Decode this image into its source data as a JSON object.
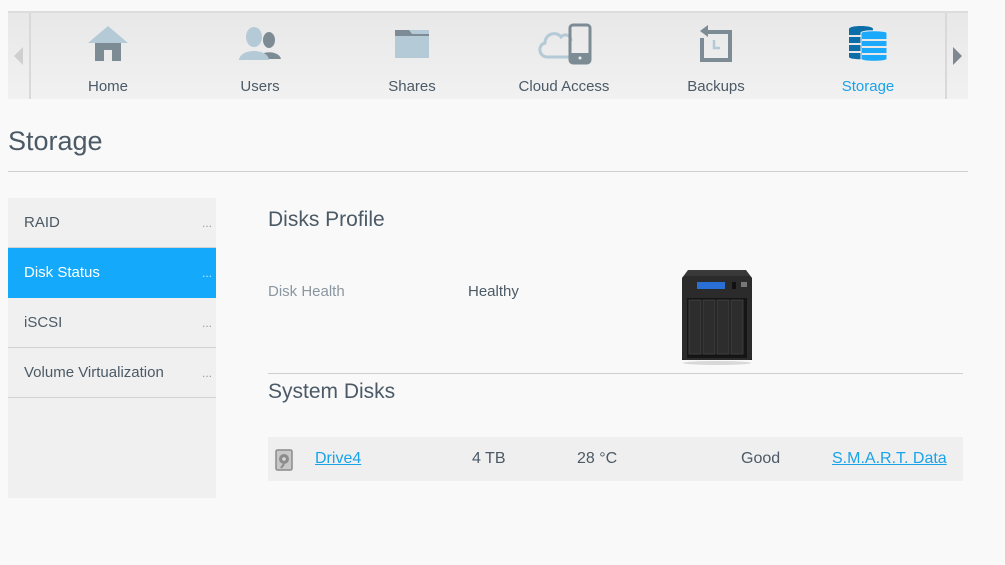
{
  "nav": {
    "items": [
      {
        "label": "Home",
        "icon": "home-icon",
        "active": false
      },
      {
        "label": "Users",
        "icon": "users-icon",
        "active": false
      },
      {
        "label": "Shares",
        "icon": "folder-icon",
        "active": false
      },
      {
        "label": "Cloud Access",
        "icon": "cloud-device-icon",
        "active": false
      },
      {
        "label": "Backups",
        "icon": "backup-clock-icon",
        "active": false
      },
      {
        "label": "Storage",
        "icon": "database-icon",
        "active": true
      }
    ],
    "accent_color": "#1aa3e8"
  },
  "page": {
    "title": "Storage"
  },
  "sidebar": {
    "items": [
      {
        "label": "RAID",
        "more": "...",
        "active": false
      },
      {
        "label": "Disk Status",
        "more": "...",
        "active": true
      },
      {
        "label": "iSCSI",
        "more": "...",
        "active": false
      },
      {
        "label": "Volume Virtualization",
        "more": "...",
        "active": false
      }
    ]
  },
  "disks_profile": {
    "heading": "Disks Profile",
    "health_label": "Disk Health",
    "health_value": "Healthy",
    "device_image": "nas-device-4-bay"
  },
  "system_disks": {
    "heading": "System Disks",
    "rows": [
      {
        "name": "Drive4",
        "capacity": "4 TB",
        "temperature": "28 °C",
        "status": "Good",
        "action": "S.M.A.R.T. Data"
      }
    ]
  }
}
